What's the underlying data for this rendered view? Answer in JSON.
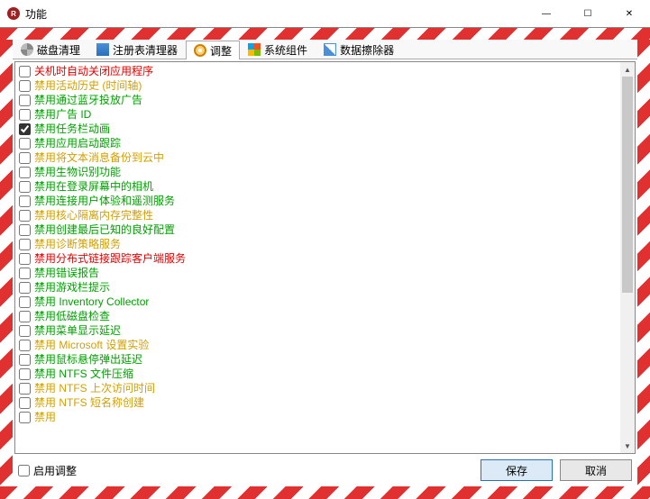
{
  "window": {
    "title": "功能"
  },
  "winbtn": {
    "min": "—",
    "max": "☐",
    "close": "✕"
  },
  "tabs": [
    {
      "id": "disk",
      "label": "磁盘清理",
      "active": false
    },
    {
      "id": "reg",
      "label": "注册表清理器",
      "active": false
    },
    {
      "id": "tweak",
      "label": "调整",
      "active": true
    },
    {
      "id": "sys",
      "label": "系统组件",
      "active": false
    },
    {
      "id": "wipe",
      "label": "数据擦除器",
      "active": false
    }
  ],
  "items": [
    {
      "checked": false,
      "color": "red",
      "label": "关机时自动关闭应用程序"
    },
    {
      "checked": false,
      "color": "gold",
      "label": "禁用活动历史 (时间轴)"
    },
    {
      "checked": false,
      "color": "green",
      "label": "禁用通过蓝牙投放广告"
    },
    {
      "checked": false,
      "color": "green",
      "label": "禁用广告 ID"
    },
    {
      "checked": true,
      "color": "green",
      "label": "禁用任务栏动画"
    },
    {
      "checked": false,
      "color": "green",
      "label": "禁用应用启动跟踪"
    },
    {
      "checked": false,
      "color": "gold",
      "label": "禁用将文本消息备份到云中"
    },
    {
      "checked": false,
      "color": "green",
      "label": "禁用生物识别功能"
    },
    {
      "checked": false,
      "color": "green",
      "label": "禁用在登录屏幕中的相机"
    },
    {
      "checked": false,
      "color": "green",
      "label": "禁用连接用户体验和遥测服务"
    },
    {
      "checked": false,
      "color": "gold",
      "label": "禁用核心隔离内存完整性"
    },
    {
      "checked": false,
      "color": "green",
      "label": "禁用创建最后已知的良好配置"
    },
    {
      "checked": false,
      "color": "gold",
      "label": "禁用诊断策略服务"
    },
    {
      "checked": false,
      "color": "red",
      "label": "禁用分布式链接跟踪客户端服务"
    },
    {
      "checked": false,
      "color": "green",
      "label": "禁用错误报告"
    },
    {
      "checked": false,
      "color": "green",
      "label": "禁用游戏栏提示"
    },
    {
      "checked": false,
      "color": "green",
      "label": "禁用 Inventory Collector"
    },
    {
      "checked": false,
      "color": "green",
      "label": "禁用低磁盘检查"
    },
    {
      "checked": false,
      "color": "green",
      "label": "禁用菜单显示延迟"
    },
    {
      "checked": false,
      "color": "gold",
      "label": "禁用 Microsoft 设置实验"
    },
    {
      "checked": false,
      "color": "green",
      "label": "禁用鼠标悬停弹出延迟"
    },
    {
      "checked": false,
      "color": "green",
      "label": "禁用 NTFS 文件压缩"
    },
    {
      "checked": false,
      "color": "gold",
      "label": "禁用 NTFS 上次访问时间"
    },
    {
      "checked": false,
      "color": "gold",
      "label": "禁用 NTFS 短名称创建"
    },
    {
      "checked": false,
      "color": "gold",
      "label": "禁用"
    }
  ],
  "bottom": {
    "enable_checked": false,
    "enable_label": "启用调整",
    "save": "保存",
    "cancel": "取消"
  }
}
